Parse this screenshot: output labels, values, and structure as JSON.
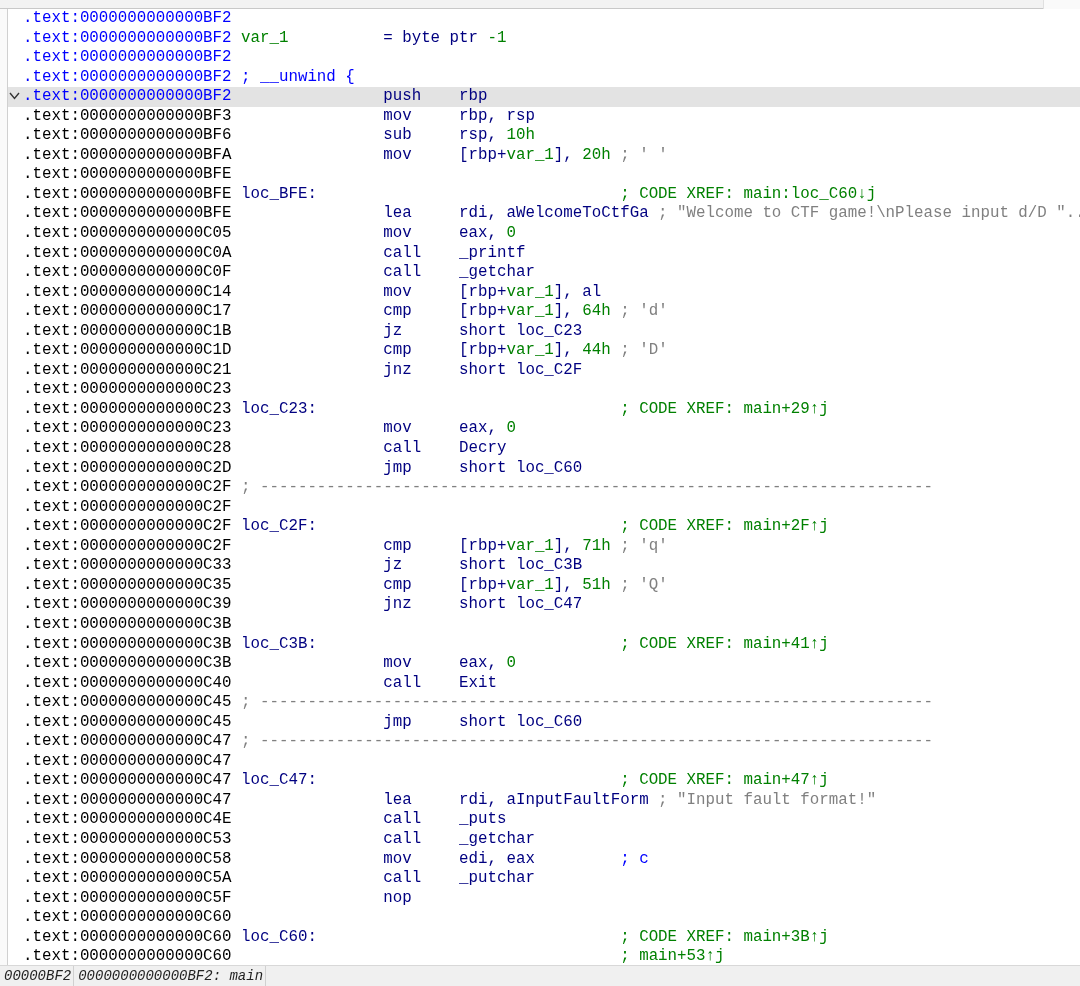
{
  "listing": {
    "lines": [
      {
        "address": ".text:0000000000000BF2",
        "color": "#0000ff",
        "selected": false
      },
      {
        "address": ".text:0000000000000BF2",
        "color": "#0000ff",
        "selected": false,
        "label": {
          "text": "var_1",
          "kind": "var"
        },
        "definition": "= byte ptr -1"
      },
      {
        "address": ".text:0000000000000BF2",
        "color": "#0000ff",
        "selected": false
      },
      {
        "address": ".text:0000000000000BF2",
        "color": "#0000ff",
        "selected": false,
        "label": {
          "text": "; __unwind {",
          "kind": "directive"
        }
      },
      {
        "address": ".text:0000000000000BF2",
        "color": "#0000ff",
        "selected": true,
        "fold": true,
        "mnemonic": "push",
        "operands": "rbp"
      },
      {
        "address": ".text:0000000000000BF3",
        "color": "#000000",
        "selected": false,
        "mnemonic": "mov",
        "operands": "rbp, rsp"
      },
      {
        "address": ".text:0000000000000BF6",
        "color": "#000000",
        "selected": false,
        "mnemonic": "sub",
        "operands": "rsp, 10h"
      },
      {
        "address": ".text:0000000000000BFA",
        "color": "#000000",
        "selected": false,
        "mnemonic": "mov",
        "operands": "[rbp+var_1], 20h",
        "comment": {
          "text": "; ' '",
          "kind": "char"
        }
      },
      {
        "address": ".text:0000000000000BFE",
        "color": "#000000",
        "selected": false
      },
      {
        "address": ".text:0000000000000BFE",
        "color": "#000000",
        "selected": false,
        "label": {
          "text": "loc_BFE:",
          "kind": "loc"
        },
        "comment": {
          "text": "; CODE XREF: main:loc_C60↓j",
          "kind": "xref"
        }
      },
      {
        "address": ".text:0000000000000BFE",
        "color": "#000000",
        "selected": false,
        "mnemonic": "lea",
        "operands": "rdi, aWelcomeToCtfGa",
        "comment": {
          "text": "; \"Welcome to CTF game!\\nPlease input d/D \"..",
          "kind": "string"
        }
      },
      {
        "address": ".text:0000000000000C05",
        "color": "#000000",
        "selected": false,
        "mnemonic": "mov",
        "operands": "eax, 0"
      },
      {
        "address": ".text:0000000000000C0A",
        "color": "#000000",
        "selected": false,
        "mnemonic": "call",
        "operands": "_printf"
      },
      {
        "address": ".text:0000000000000C0F",
        "color": "#000000",
        "selected": false,
        "mnemonic": "call",
        "operands": "_getchar"
      },
      {
        "address": ".text:0000000000000C14",
        "color": "#000000",
        "selected": false,
        "mnemonic": "mov",
        "operands": "[rbp+var_1], al"
      },
      {
        "address": ".text:0000000000000C17",
        "color": "#000000",
        "selected": false,
        "mnemonic": "cmp",
        "operands": "[rbp+var_1], 64h",
        "comment": {
          "text": "; 'd'",
          "kind": "char"
        }
      },
      {
        "address": ".text:0000000000000C1B",
        "color": "#000000",
        "selected": false,
        "mnemonic": "jz",
        "operands": "short loc_C23"
      },
      {
        "address": ".text:0000000000000C1D",
        "color": "#000000",
        "selected": false,
        "mnemonic": "cmp",
        "operands": "[rbp+var_1], 44h",
        "comment": {
          "text": "; 'D'",
          "kind": "char"
        }
      },
      {
        "address": ".text:0000000000000C21",
        "color": "#000000",
        "selected": false,
        "mnemonic": "jnz",
        "operands": "short loc_C2F"
      },
      {
        "address": ".text:0000000000000C23",
        "color": "#000000",
        "selected": false
      },
      {
        "address": ".text:0000000000000C23",
        "color": "#000000",
        "selected": false,
        "label": {
          "text": "loc_C23:",
          "kind": "loc"
        },
        "comment": {
          "text": "; CODE XREF: main+29↑j",
          "kind": "xref"
        }
      },
      {
        "address": ".text:0000000000000C23",
        "color": "#000000",
        "selected": false,
        "mnemonic": "mov",
        "operands": "eax, 0"
      },
      {
        "address": ".text:0000000000000C28",
        "color": "#000000",
        "selected": false,
        "mnemonic": "call",
        "operands": "Decry"
      },
      {
        "address": ".text:0000000000000C2D",
        "color": "#000000",
        "selected": false,
        "mnemonic": "jmp",
        "operands": "short loc_C60"
      },
      {
        "address": ".text:0000000000000C2F",
        "color": "#000000",
        "selected": false,
        "label": {
          "text": "; -----------------------------------------------------------------------",
          "kind": "separator"
        }
      },
      {
        "address": ".text:0000000000000C2F",
        "color": "#000000",
        "selected": false
      },
      {
        "address": ".text:0000000000000C2F",
        "color": "#000000",
        "selected": false,
        "label": {
          "text": "loc_C2F:",
          "kind": "loc"
        },
        "comment": {
          "text": "; CODE XREF: main+2F↑j",
          "kind": "xref"
        }
      },
      {
        "address": ".text:0000000000000C2F",
        "color": "#000000",
        "selected": false,
        "mnemonic": "cmp",
        "operands": "[rbp+var_1], 71h",
        "comment": {
          "text": "; 'q'",
          "kind": "char"
        }
      },
      {
        "address": ".text:0000000000000C33",
        "color": "#000000",
        "selected": false,
        "mnemonic": "jz",
        "operands": "short loc_C3B"
      },
      {
        "address": ".text:0000000000000C35",
        "color": "#000000",
        "selected": false,
        "mnemonic": "cmp",
        "operands": "[rbp+var_1], 51h",
        "comment": {
          "text": "; 'Q'",
          "kind": "char"
        }
      },
      {
        "address": ".text:0000000000000C39",
        "color": "#000000",
        "selected": false,
        "mnemonic": "jnz",
        "operands": "short loc_C47"
      },
      {
        "address": ".text:0000000000000C3B",
        "color": "#000000",
        "selected": false
      },
      {
        "address": ".text:0000000000000C3B",
        "color": "#000000",
        "selected": false,
        "label": {
          "text": "loc_C3B:",
          "kind": "loc"
        },
        "comment": {
          "text": "; CODE XREF: main+41↑j",
          "kind": "xref"
        }
      },
      {
        "address": ".text:0000000000000C3B",
        "color": "#000000",
        "selected": false,
        "mnemonic": "mov",
        "operands": "eax, 0"
      },
      {
        "address": ".text:0000000000000C40",
        "color": "#000000",
        "selected": false,
        "mnemonic": "call",
        "operands": "Exit"
      },
      {
        "address": ".text:0000000000000C45",
        "color": "#000000",
        "selected": false,
        "label": {
          "text": "; -----------------------------------------------------------------------",
          "kind": "separator"
        }
      },
      {
        "address": ".text:0000000000000C45",
        "color": "#000000",
        "selected": false,
        "mnemonic": "jmp",
        "operands": "short loc_C60"
      },
      {
        "address": ".text:0000000000000C47",
        "color": "#000000",
        "selected": false,
        "label": {
          "text": "; -----------------------------------------------------------------------",
          "kind": "separator"
        }
      },
      {
        "address": ".text:0000000000000C47",
        "color": "#000000",
        "selected": false
      },
      {
        "address": ".text:0000000000000C47",
        "color": "#000000",
        "selected": false,
        "label": {
          "text": "loc_C47:",
          "kind": "loc"
        },
        "comment": {
          "text": "; CODE XREF: main+47↑j",
          "kind": "xref"
        }
      },
      {
        "address": ".text:0000000000000C47",
        "color": "#000000",
        "selected": false,
        "mnemonic": "lea",
        "operands": "rdi, aInputFaultForm",
        "comment": {
          "text": "; \"Input fault format!\"",
          "kind": "string"
        }
      },
      {
        "address": ".text:0000000000000C4E",
        "color": "#000000",
        "selected": false,
        "mnemonic": "call",
        "operands": "_puts"
      },
      {
        "address": ".text:0000000000000C53",
        "color": "#000000",
        "selected": false,
        "mnemonic": "call",
        "operands": "_getchar"
      },
      {
        "address": ".text:0000000000000C58",
        "color": "#000000",
        "selected": false,
        "mnemonic": "mov",
        "operands": "edi, eax",
        "comment": {
          "text": "; c",
          "kind": "arg"
        }
      },
      {
        "address": ".text:0000000000000C5A",
        "color": "#000000",
        "selected": false,
        "mnemonic": "call",
        "operands": "_putchar"
      },
      {
        "address": ".text:0000000000000C5F",
        "color": "#000000",
        "selected": false,
        "mnemonic": "nop"
      },
      {
        "address": ".text:0000000000000C60",
        "color": "#000000",
        "selected": false
      },
      {
        "address": ".text:0000000000000C60",
        "color": "#000000",
        "selected": false,
        "label": {
          "text": "loc_C60:",
          "kind": "loc"
        },
        "comment": {
          "text": "; CODE XREF: main+3B↑j",
          "kind": "xref"
        }
      },
      {
        "address": ".text:0000000000000C60",
        "color": "#000000",
        "selected": false,
        "comment": {
          "text": "; main+53↑j",
          "kind": "xref"
        }
      }
    ]
  },
  "status_bar": {
    "offset": "00000BF2",
    "location": "0000000000000BF2: main"
  }
}
